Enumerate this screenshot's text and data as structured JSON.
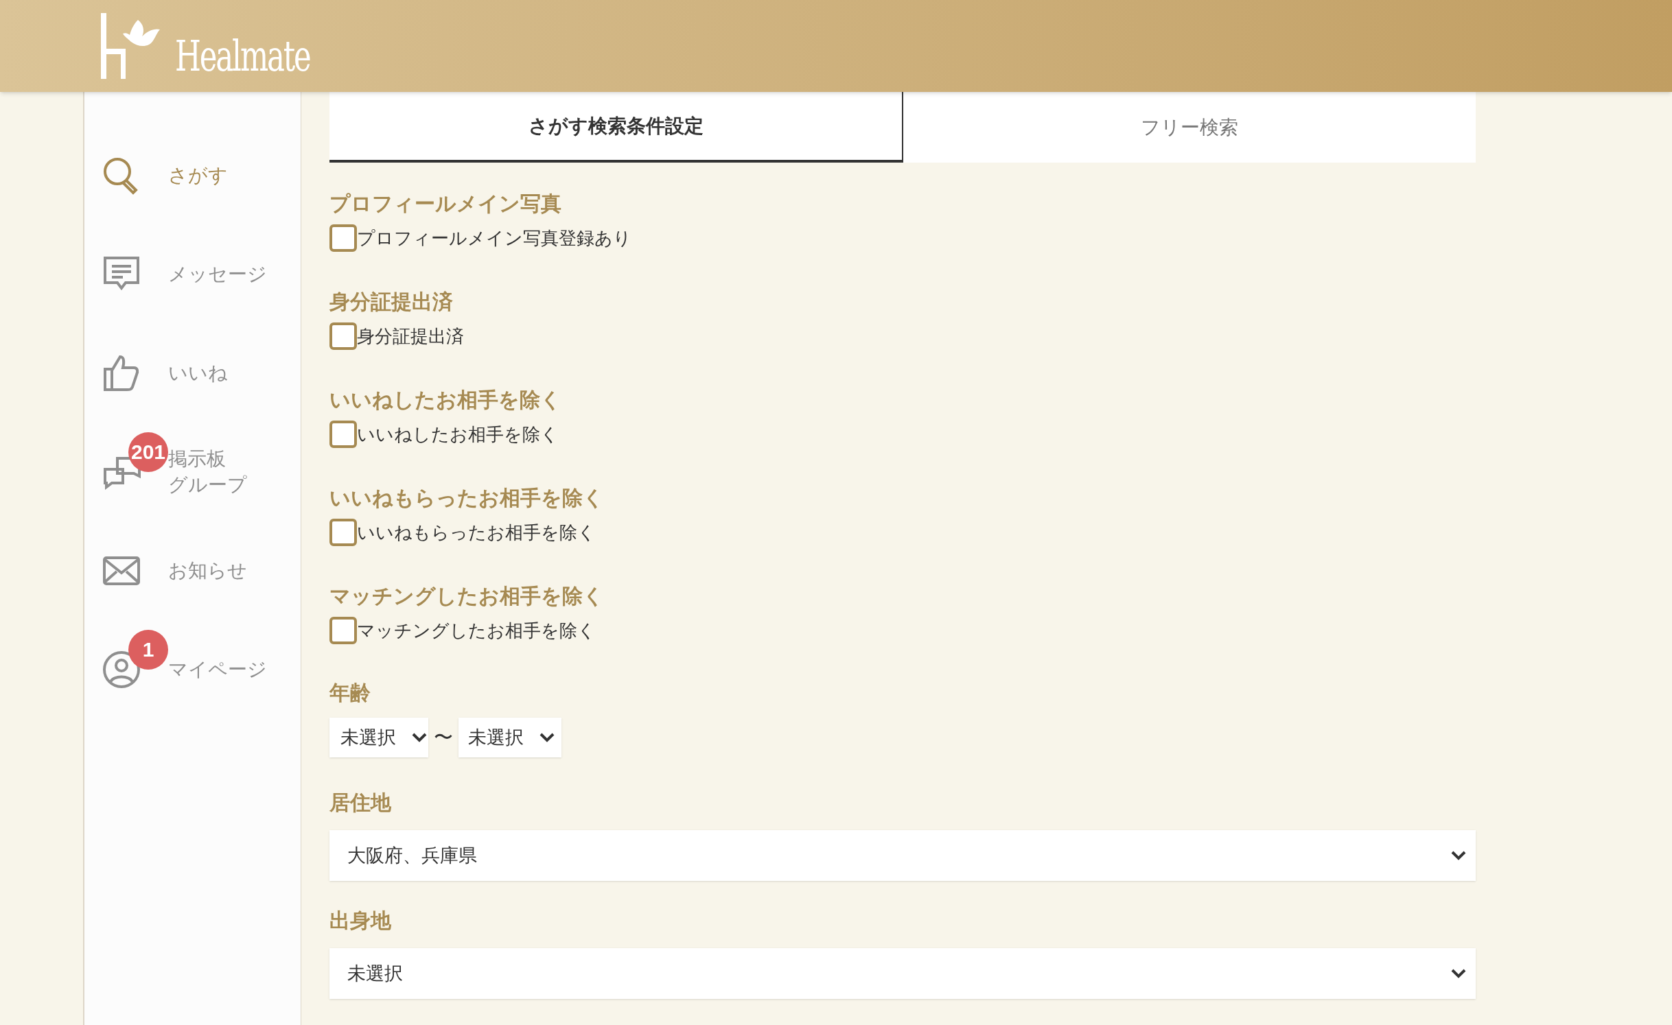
{
  "header": {
    "logo_text": "Healmate"
  },
  "sidebar": {
    "items": [
      {
        "kind": "search",
        "label_lines": [
          "さがす"
        ],
        "selected": true
      },
      {
        "kind": "message",
        "label_lines": [
          "メッセージ"
        ],
        "selected": false
      },
      {
        "kind": "like",
        "label_lines": [
          "いいね"
        ],
        "selected": false
      },
      {
        "kind": "board",
        "label_lines": [
          "掲示板",
          "グループ"
        ],
        "selected": false,
        "badge": "201"
      },
      {
        "kind": "notice",
        "label_lines": [
          "お知らせ"
        ],
        "selected": false
      },
      {
        "kind": "mypage",
        "label_lines": [
          "マイページ"
        ],
        "selected": false,
        "badge": "1"
      }
    ]
  },
  "tabs": [
    {
      "label": "さがす検索条件設定",
      "selected": true
    },
    {
      "label": "フリー検索",
      "selected": false
    }
  ],
  "sections": [
    {
      "kind": "checkbox",
      "title": "プロフィールメイン写真",
      "label": "プロフィールメイン写真登録あり",
      "checked": false
    },
    {
      "kind": "checkbox",
      "title": "身分証提出済",
      "label": "身分証提出済",
      "checked": false
    },
    {
      "kind": "checkbox",
      "title": "いいねしたお相手を除く",
      "label": "いいねしたお相手を除く",
      "checked": false
    },
    {
      "kind": "checkbox",
      "title": "いいねもらったお相手を除く",
      "label": "いいねもらったお相手を除く",
      "checked": false
    },
    {
      "kind": "checkbox",
      "title": "マッチングしたお相手を除く",
      "label": "マッチングしたお相手を除く",
      "checked": false
    },
    {
      "kind": "range",
      "title": "年齢",
      "from": "未選択",
      "separator": "〜",
      "to": "未選択"
    },
    {
      "kind": "select",
      "title": "居住地",
      "value": "大阪府、兵庫県"
    },
    {
      "kind": "select",
      "title": "出身地",
      "value": "未選択"
    }
  ]
}
